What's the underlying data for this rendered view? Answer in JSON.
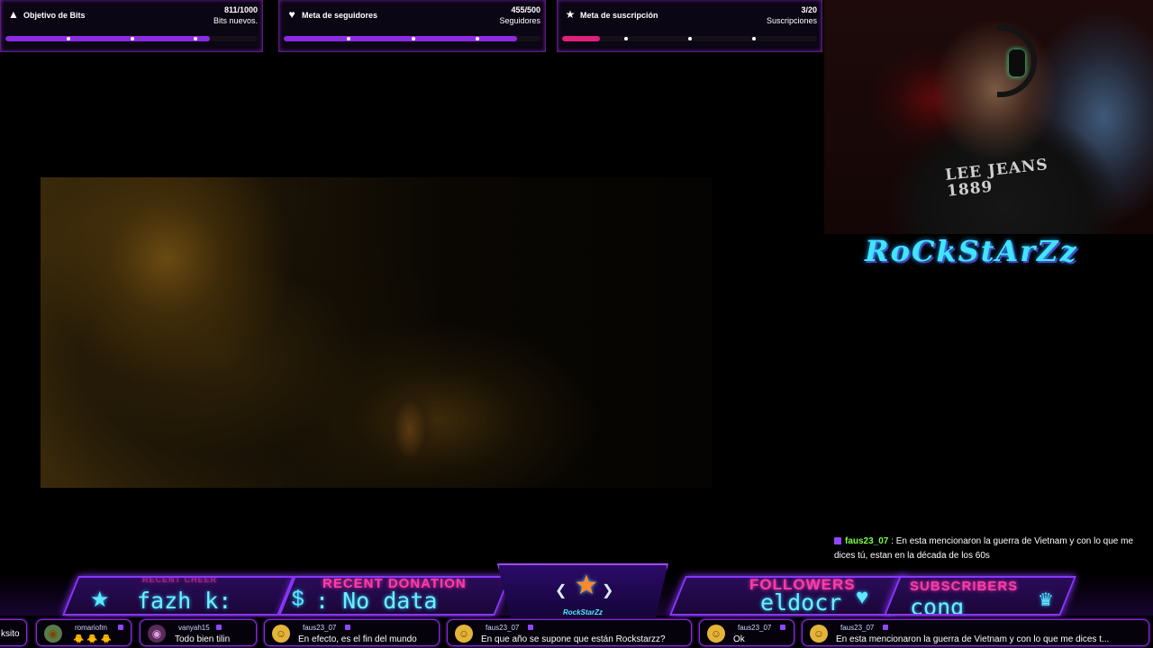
{
  "goals": [
    {
      "icon": "bits-icon",
      "glyph": "▲",
      "title": "Objetivo de Bits",
      "value": "811/1000",
      "unit": "Bits nuevos.",
      "progress": 0.811,
      "color": "#8b2be2"
    },
    {
      "icon": "followers-icon",
      "glyph": "♥",
      "title": "Meta de seguidores",
      "value": "455/500",
      "unit": "Seguidores",
      "progress": 0.91,
      "color": "#8b2be2"
    },
    {
      "icon": "subs-icon",
      "glyph": "★",
      "title": "Meta de suscripción",
      "value": "3/20",
      "unit": "Suscripciones",
      "progress": 0.15,
      "color": "#e0207a"
    }
  ],
  "webcam": {
    "shirt_text": "LEE JEANS\n1889"
  },
  "logo_text": "RoCkStArZz",
  "chat_overlay": {
    "user": "faus23_07",
    "separator": " : ",
    "message": "En esta mencionaron la guerra de Vietnam y con lo que me dices tú, estan en la década de los 60s"
  },
  "panels": {
    "recent_cheer": {
      "label": "RECENT CHEER",
      "value": "fazh  k:",
      "icon": "star-icon"
    },
    "recent_donation": {
      "label": "RECENT DONATION",
      "value": ": No data",
      "icon": "money-icon"
    },
    "center_text": "RockStarZz",
    "followers": {
      "label": "FOLLOWERS",
      "value": "eldocr",
      "icon": "heart-icon"
    },
    "subscribers": {
      "label": "SUBSCRIBERS",
      "value": "cong",
      "icon": "trophy-icon"
    }
  },
  "ticker": [
    {
      "user": "",
      "message": "ksito"
    },
    {
      "user": "romariofm",
      "message": "🐥 🐥 🐥"
    },
    {
      "user": "vanyah15",
      "message": "Todo bien tilin"
    },
    {
      "user": "faus23_07",
      "message": "En efecto, es el fin del mundo"
    },
    {
      "user": "faus23_07",
      "message": "En que año se supone que están Rockstarzz?"
    },
    {
      "user": "faus23_07",
      "message": "Ok"
    },
    {
      "user": "faus23_07",
      "message": "En esta mencionaron la guerra de Vietnam y con lo que me dices t..."
    }
  ]
}
